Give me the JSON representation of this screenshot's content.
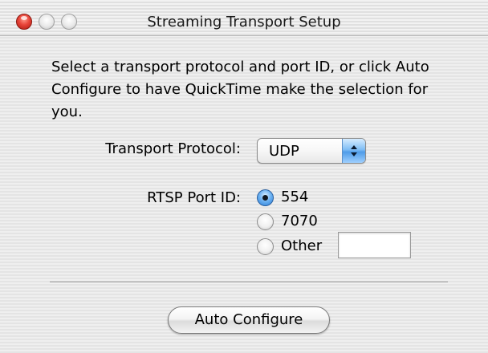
{
  "window": {
    "title": "Streaming Transport Setup"
  },
  "description": "Select a transport protocol and port ID, or click Auto Configure to have QuickTime make the selection for you.",
  "transport": {
    "label": "Transport Protocol:",
    "selected": "UDP"
  },
  "port": {
    "label": "RTSP Port ID:",
    "options": [
      {
        "label": "554",
        "checked": true
      },
      {
        "label": "7070",
        "checked": false
      },
      {
        "label": "Other",
        "checked": false
      }
    ],
    "other_value": ""
  },
  "buttons": {
    "auto_configure": "Auto Configure"
  }
}
